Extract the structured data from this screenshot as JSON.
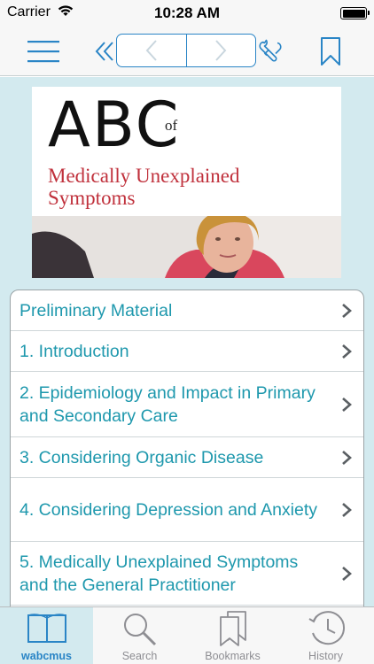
{
  "status_bar": {
    "carrier": "Carrier",
    "time": "10:28 AM"
  },
  "toolbar": {
    "accent_color": "#2a85c6",
    "icons": [
      "hamburger-menu-icon",
      "double-chevron-left-icon",
      "chevron-left-icon",
      "chevron-right-icon",
      "wrench-icon",
      "bookmark-icon"
    ]
  },
  "cover": {
    "abc": "ABC",
    "of": "of",
    "title": "Medically Unexplained Symptoms",
    "title_color": "#c0313c"
  },
  "toc": {
    "text_color": "#1e98ad",
    "items": [
      {
        "label": "Preliminary Material"
      },
      {
        "label": "1. Introduction"
      },
      {
        "label": "2. Epidemiology and Impact in Primary and Secondary Care"
      },
      {
        "label": "3. Considering Organic Disease"
      },
      {
        "label": "4. Considering Depression and Anxiety"
      },
      {
        "label": "5. Medically Unexplained Symptoms and the General Practitioner"
      }
    ]
  },
  "tabbar": {
    "tabs": [
      {
        "label": "wabcmus",
        "icon": "open-book-icon",
        "active": true
      },
      {
        "label": "Search",
        "icon": "magnifier-icon",
        "active": false
      },
      {
        "label": "Bookmarks",
        "icon": "bookmarks-icon",
        "active": false
      },
      {
        "label": "History",
        "icon": "clock-history-icon",
        "active": false
      }
    ]
  }
}
